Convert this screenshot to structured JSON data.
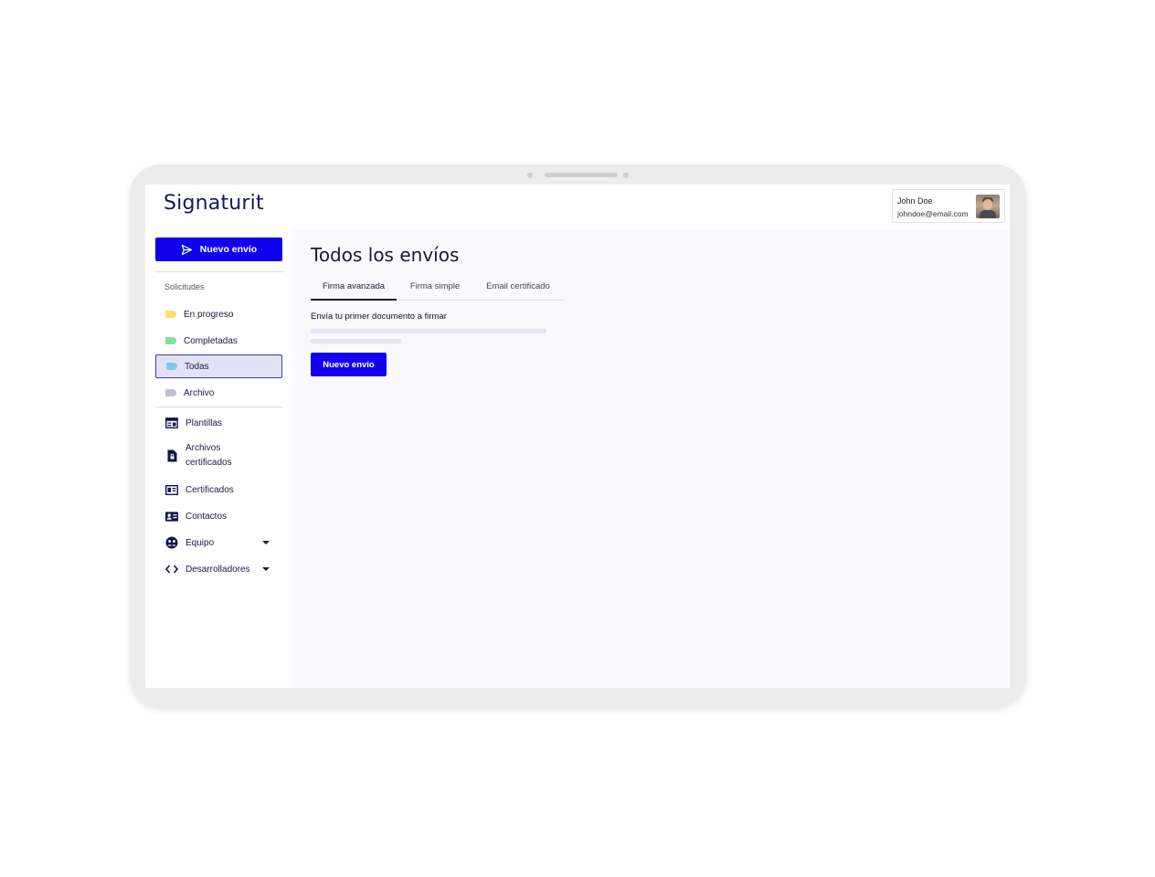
{
  "app": {
    "logo_text": "Signaturit"
  },
  "user": {
    "name": "John Doe",
    "email": "johndoe@email.com"
  },
  "sidebar": {
    "new_button_label": "Nuevo envío",
    "section_label": "Solicitudes",
    "request_items": [
      {
        "label": "En progreso",
        "color": "#f7df72"
      },
      {
        "label": "Completadas",
        "color": "#7fe0a0"
      },
      {
        "label": "Todas",
        "color": "#7ecbf2"
      },
      {
        "label": "Archivo",
        "color": "#c0c0cc"
      }
    ],
    "nav_items": [
      {
        "label": "Plantillas",
        "icon": "template-icon"
      },
      {
        "label": "Archivos\ncertificados",
        "icon": "certified-file-icon"
      },
      {
        "label": "Certificados",
        "icon": "certificate-icon"
      },
      {
        "label": "Contactos",
        "icon": "contact-card-icon"
      },
      {
        "label": "Equipo",
        "icon": "team-icon"
      },
      {
        "label": "Desarrolladores",
        "icon": "code-icon"
      }
    ]
  },
  "main": {
    "title": "Todos los envíos",
    "tabs": [
      {
        "label": "Firma avanzada"
      },
      {
        "label": "Firma simple"
      },
      {
        "label": "Email certificado"
      }
    ],
    "empty_title": "Envía tu primer documento a firmar",
    "button_label": "Nuevo envío"
  },
  "colors": {
    "accent": "#1000ee",
    "active_bg": "#e3e2f5"
  }
}
